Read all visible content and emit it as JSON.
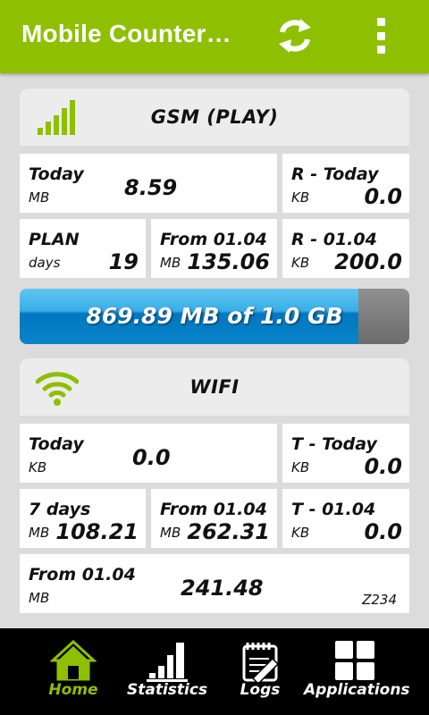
{
  "app": {
    "title": "Mobile Counter…"
  },
  "gsm": {
    "title": "GSM (PLAY)",
    "today": {
      "label": "Today",
      "unit": "MB",
      "value": "8.59"
    },
    "r_today": {
      "label": "R - Today",
      "unit": "KB",
      "value": "0.0"
    },
    "plan": {
      "label": "PLAN",
      "unit": "days",
      "value": "19"
    },
    "from": {
      "label": "From 01.04",
      "unit": "MB",
      "value": "135.06"
    },
    "r_from": {
      "label": "R - 01.04",
      "unit": "KB",
      "value": "200.0"
    },
    "usage": {
      "text": "869.89 MB of 1.0 GB",
      "used_mb": 869.89,
      "limit_gb": 1.0
    }
  },
  "wifi": {
    "title": "WIFI",
    "today": {
      "label": "Today",
      "unit": "KB",
      "value": "0.0"
    },
    "t_today": {
      "label": "T - Today",
      "unit": "KB",
      "value": "0.0"
    },
    "seven_days": {
      "label": "7 days",
      "unit": "MB",
      "value": "108.21"
    },
    "from": {
      "label": "From 01.04",
      "unit": "MB",
      "value": "262.31"
    },
    "t_from": {
      "label": "T - 01.04",
      "unit": "KB",
      "value": "0.0"
    },
    "total": {
      "label": "From 01.04",
      "unit": "MB",
      "value": "241.48",
      "extra": "Z234"
    }
  },
  "nav": [
    {
      "label": "Home",
      "icon": "home-icon",
      "active": true
    },
    {
      "label": "Statistics",
      "icon": "statistics-icon",
      "active": false
    },
    {
      "label": "Logs",
      "icon": "logs-icon",
      "active": false
    },
    {
      "label": "Applications",
      "icon": "applications-icon",
      "active": false
    }
  ],
  "colors": {
    "accent": "#8ebf00",
    "progress": "#0a84c9",
    "nav_bg": "#000000"
  }
}
